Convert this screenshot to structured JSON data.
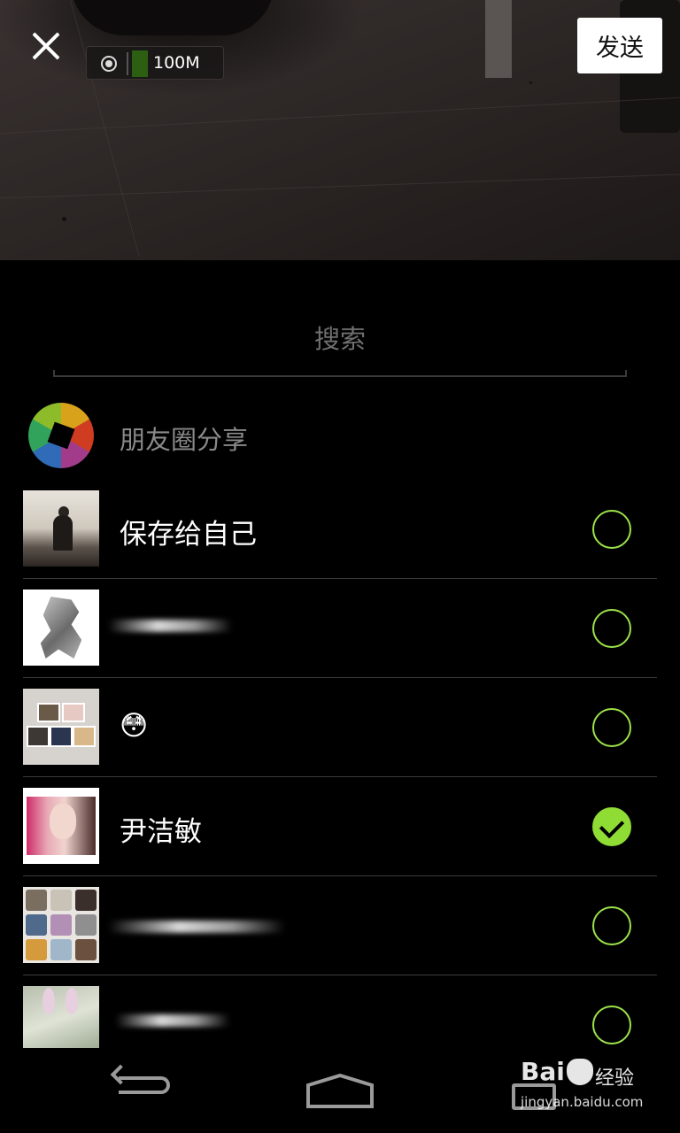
{
  "header": {
    "close_icon": "close-icon",
    "size_indicator": {
      "icon": "network-icon",
      "size_label": "100M"
    },
    "send_label": "发送"
  },
  "search": {
    "placeholder": "搜索"
  },
  "moments": {
    "icon": "aperture-icon",
    "label": "朋友圈分享"
  },
  "contacts": [
    {
      "name": "保存给自己",
      "selected": false
    },
    {
      "name": "",
      "selected": false
    },
    {
      "name": "😳",
      "selected": false
    },
    {
      "name": "尹洁敏",
      "selected": true
    },
    {
      "name": "",
      "selected": false
    },
    {
      "name": "",
      "selected": false
    }
  ],
  "colors": {
    "accent_check": "#8fdc35",
    "send_bg": "#ffffff",
    "background": "#000000"
  },
  "navbar": {
    "back_icon": "back-icon",
    "home_icon": "home-icon",
    "recent_icon": "recent-apps-icon"
  },
  "watermark": {
    "brand": "Bai",
    "brand_cn": "经验",
    "url": "jingyan.baidu.com"
  }
}
